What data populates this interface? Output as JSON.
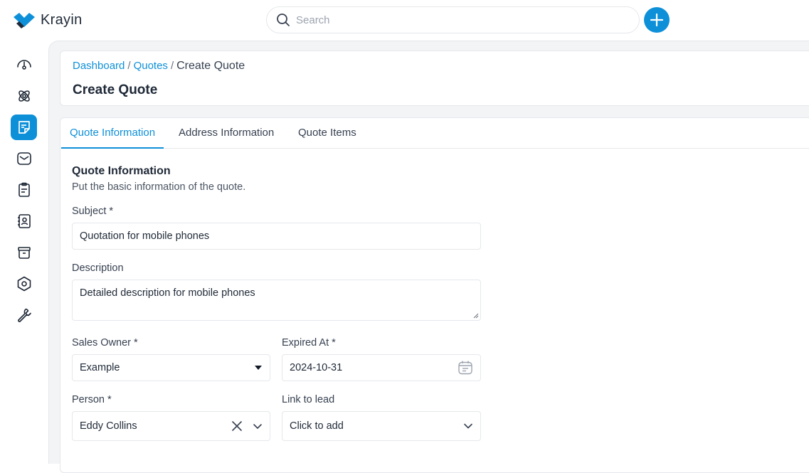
{
  "app": {
    "name": "Krayin"
  },
  "search": {
    "placeholder": "Search"
  },
  "sidebar": {
    "items": [
      {
        "icon": "dashboard-icon"
      },
      {
        "icon": "leads-icon"
      },
      {
        "icon": "quotes-icon",
        "active": true
      },
      {
        "icon": "mail-icon"
      },
      {
        "icon": "activities-icon"
      },
      {
        "icon": "contacts-icon"
      },
      {
        "icon": "products-icon"
      },
      {
        "icon": "settings-icon"
      },
      {
        "icon": "configuration-icon"
      }
    ]
  },
  "breadcrumb": {
    "dashboard": "Dashboard",
    "quotes": "Quotes",
    "current": "Create Quote",
    "sep": "/"
  },
  "page": {
    "title": "Create Quote"
  },
  "tabs": [
    {
      "label": "Quote Information",
      "active": true
    },
    {
      "label": "Address Information"
    },
    {
      "label": "Quote Items"
    }
  ],
  "section": {
    "title": "Quote Information",
    "subtitle": "Put the basic information of the quote."
  },
  "form": {
    "subject": {
      "label": "Subject *",
      "value": "Quotation for mobile phones"
    },
    "description": {
      "label": "Description",
      "value": "Detailed description for mobile phones"
    },
    "sales_owner": {
      "label": "Sales Owner *",
      "value": "Example"
    },
    "expired_at": {
      "label": "Expired At *",
      "value": "2024-10-31"
    },
    "person": {
      "label": "Person *",
      "value": "Eddy Collins"
    },
    "link_to_lead": {
      "label": "Link to lead",
      "value": "Click to add"
    }
  },
  "colors": {
    "accent": "#0e90d9",
    "background": "#f3f4f6",
    "border": "#e5e7eb"
  }
}
